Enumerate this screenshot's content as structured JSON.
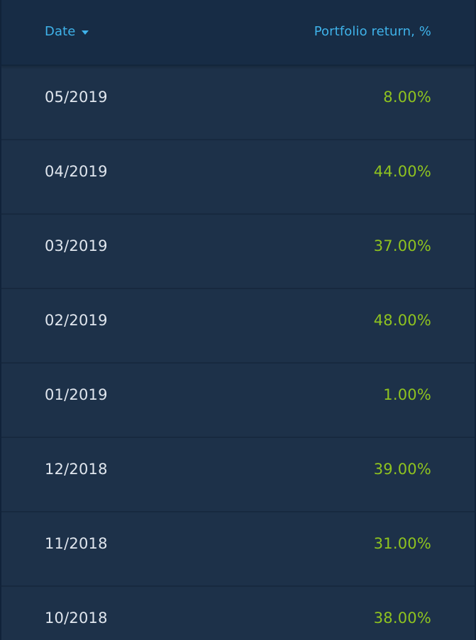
{
  "table": {
    "header": {
      "date_label": "Date",
      "return_label": "Portfolio return, %",
      "sort_icon": "caret-down-icon"
    },
    "rows": [
      {
        "date": "05/2019",
        "return": "8.00%"
      },
      {
        "date": "04/2019",
        "return": "44.00%"
      },
      {
        "date": "03/2019",
        "return": "37.00%"
      },
      {
        "date": "02/2019",
        "return": "48.00%"
      },
      {
        "date": "01/2019",
        "return": "1.00%"
      },
      {
        "date": "12/2018",
        "return": "39.00%"
      },
      {
        "date": "11/2018",
        "return": "31.00%"
      },
      {
        "date": "10/2018",
        "return": "38.00%"
      }
    ]
  },
  "colors": {
    "background": "#1d3149",
    "header_background": "#172c45",
    "header_text": "#3fb3ea",
    "date_text": "#e0e6ee",
    "positive_return": "#8fc31f"
  }
}
